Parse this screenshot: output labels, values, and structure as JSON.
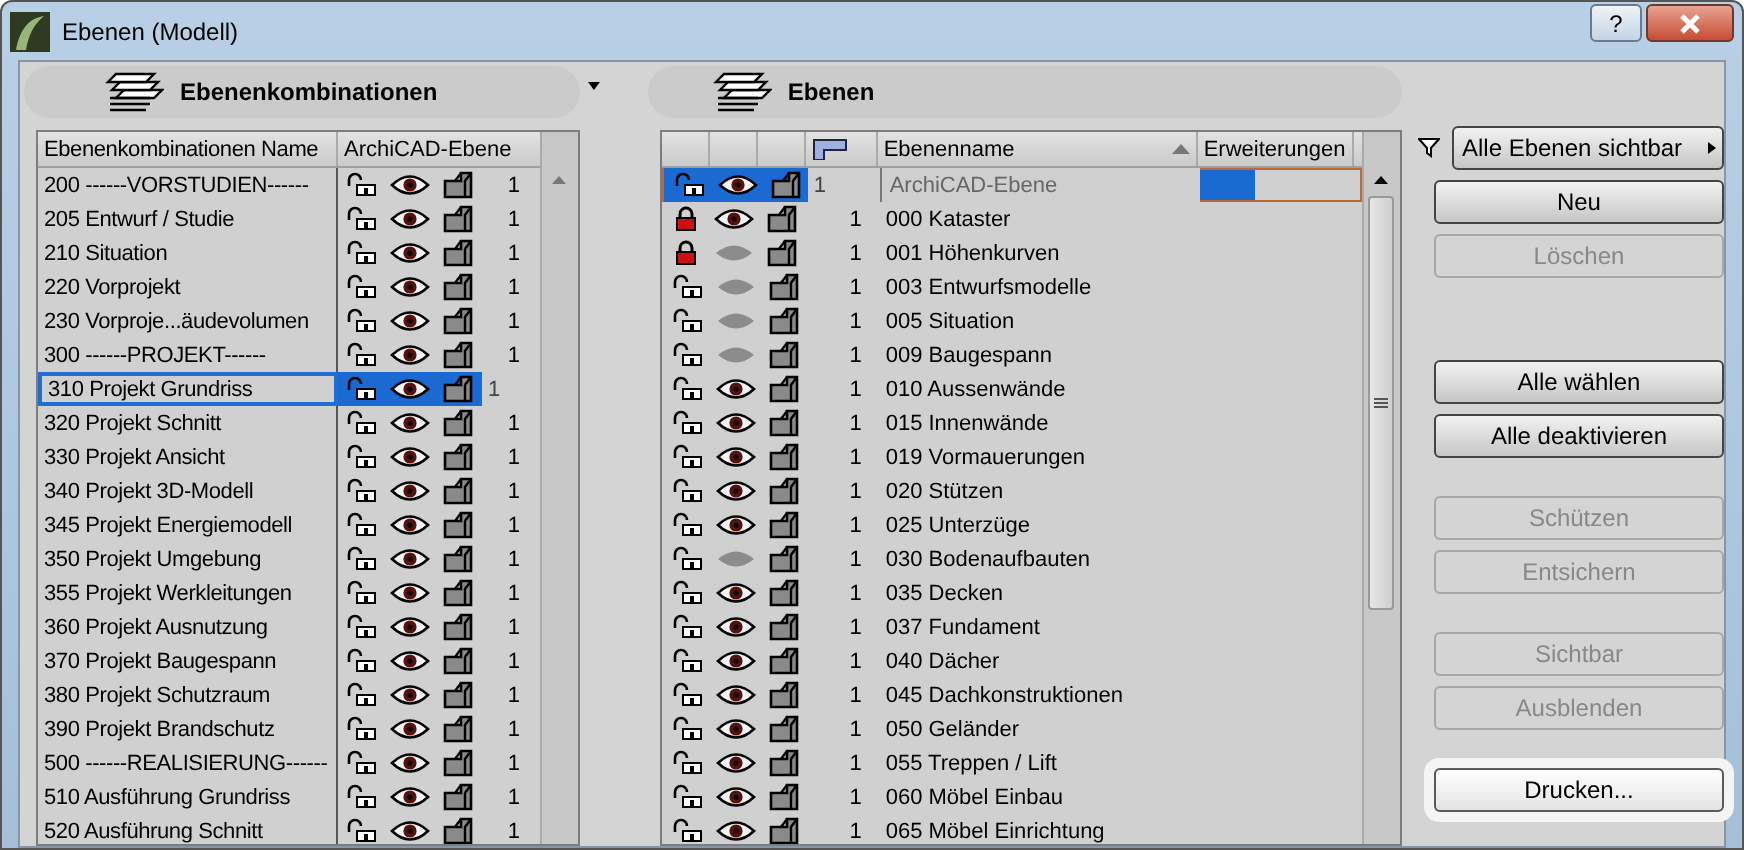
{
  "window": {
    "title": "Ebenen (Modell)",
    "help": "?"
  },
  "combinations": {
    "header": "Ebenenkombinationen",
    "columns": [
      "Ebenenkombinationen Name",
      "ArchiCAD-Ebene"
    ],
    "rows": [
      {
        "name": "200 ------VORSTUDIEN------",
        "locked": false,
        "visible": true,
        "number": "1",
        "selected": false
      },
      {
        "name": "205 Entwurf / Studie",
        "locked": false,
        "visible": true,
        "number": "1",
        "selected": false
      },
      {
        "name": "210 Situation",
        "locked": false,
        "visible": true,
        "number": "1",
        "selected": false
      },
      {
        "name": "220 Vorprojekt",
        "locked": false,
        "visible": true,
        "number": "1",
        "selected": false
      },
      {
        "name": "230 Vorproje...äudevolumen",
        "locked": false,
        "visible": true,
        "number": "1",
        "selected": false
      },
      {
        "name": "300 ------PROJEKT------",
        "locked": false,
        "visible": true,
        "number": "1",
        "selected": false
      },
      {
        "name": "310 Projekt Grundriss",
        "locked": false,
        "visible": true,
        "number": "1",
        "selected": true
      },
      {
        "name": "320 Projekt Schnitt",
        "locked": false,
        "visible": true,
        "number": "1",
        "selected": false
      },
      {
        "name": "330 Projekt Ansicht",
        "locked": false,
        "visible": true,
        "number": "1",
        "selected": false
      },
      {
        "name": "340 Projekt 3D-Modell",
        "locked": false,
        "visible": true,
        "number": "1",
        "selected": false
      },
      {
        "name": "345 Projekt Energiemodell",
        "locked": false,
        "visible": true,
        "number": "1",
        "selected": false
      },
      {
        "name": "350 Projekt Umgebung",
        "locked": false,
        "visible": true,
        "number": "1",
        "selected": false
      },
      {
        "name": "355 Projekt Werkleitungen",
        "locked": false,
        "visible": true,
        "number": "1",
        "selected": false
      },
      {
        "name": "360 Projekt Ausnutzung",
        "locked": false,
        "visible": true,
        "number": "1",
        "selected": false
      },
      {
        "name": "370 Projekt Baugespann",
        "locked": false,
        "visible": true,
        "number": "1",
        "selected": false
      },
      {
        "name": "380 Projekt Schutzraum",
        "locked": false,
        "visible": true,
        "number": "1",
        "selected": false
      },
      {
        "name": "390 Projekt Brandschutz",
        "locked": false,
        "visible": true,
        "number": "1",
        "selected": false
      },
      {
        "name": "500 ------REALISIERUNG------",
        "locked": false,
        "visible": true,
        "number": "1",
        "selected": false
      },
      {
        "name": "510 Ausführung Grundriss",
        "locked": false,
        "visible": true,
        "number": "1",
        "selected": false
      },
      {
        "name": "520 Ausführung Schnitt",
        "locked": false,
        "visible": true,
        "number": "1",
        "selected": false
      }
    ]
  },
  "layers": {
    "header": "Ebenen",
    "columns": [
      "Ebenenname",
      "Erweiterungen"
    ],
    "rows": [
      {
        "name": "ArchiCAD-Ebene",
        "locked": false,
        "visible": true,
        "number": "1",
        "selected": true
      },
      {
        "name": "000 Kataster",
        "locked": true,
        "visible": true,
        "number": "1",
        "selected": false
      },
      {
        "name": "001 Höhenkurven",
        "locked": true,
        "visible": false,
        "number": "1",
        "selected": false
      },
      {
        "name": "003 Entwurfsmodelle",
        "locked": false,
        "visible": false,
        "number": "1",
        "selected": false
      },
      {
        "name": "005 Situation",
        "locked": false,
        "visible": false,
        "number": "1",
        "selected": false
      },
      {
        "name": "009 Baugespann",
        "locked": false,
        "visible": false,
        "number": "1",
        "selected": false
      },
      {
        "name": "010 Aussenwände",
        "locked": false,
        "visible": true,
        "number": "1",
        "selected": false
      },
      {
        "name": "015 Innenwände",
        "locked": false,
        "visible": true,
        "number": "1",
        "selected": false
      },
      {
        "name": "019 Vormauerungen",
        "locked": false,
        "visible": true,
        "number": "1",
        "selected": false
      },
      {
        "name": "020 Stützen",
        "locked": false,
        "visible": true,
        "number": "1",
        "selected": false
      },
      {
        "name": "025 Unterzüge",
        "locked": false,
        "visible": true,
        "number": "1",
        "selected": false
      },
      {
        "name": "030 Bodenaufbauten",
        "locked": false,
        "visible": false,
        "number": "1",
        "selected": false
      },
      {
        "name": "035 Decken",
        "locked": false,
        "visible": true,
        "number": "1",
        "selected": false
      },
      {
        "name": "037 Fundament",
        "locked": false,
        "visible": true,
        "number": "1",
        "selected": false
      },
      {
        "name": "040 Dächer",
        "locked": false,
        "visible": true,
        "number": "1",
        "selected": false
      },
      {
        "name": "045 Dachkonstruktionen",
        "locked": false,
        "visible": true,
        "number": "1",
        "selected": false
      },
      {
        "name": "050 Geländer",
        "locked": false,
        "visible": true,
        "number": "1",
        "selected": false
      },
      {
        "name": "055 Treppen / Lift",
        "locked": false,
        "visible": true,
        "number": "1",
        "selected": false
      },
      {
        "name": "060 Möbel Einbau",
        "locked": false,
        "visible": true,
        "number": "1",
        "selected": false
      },
      {
        "name": "065 Möbel Einrichtung",
        "locked": false,
        "visible": true,
        "number": "1",
        "selected": false
      }
    ]
  },
  "filter": {
    "label": "Alle Ebenen sichtbar"
  },
  "button_groups": [
    [
      {
        "label": "Neu",
        "disabled": false,
        "focused": false
      },
      {
        "label": "Löschen",
        "disabled": true,
        "focused": false
      }
    ],
    [
      {
        "label": "Alle wählen",
        "disabled": false,
        "focused": false
      },
      {
        "label": "Alle deaktivieren",
        "disabled": false,
        "focused": false
      }
    ],
    [
      {
        "label": "Schützen",
        "disabled": true,
        "focused": false
      },
      {
        "label": "Entsichern",
        "disabled": true,
        "focused": false
      }
    ],
    [
      {
        "label": "Sichtbar",
        "disabled": true,
        "focused": false
      },
      {
        "label": "Ausblenden",
        "disabled": true,
        "focused": false
      }
    ],
    [
      {
        "label": "Drucken...",
        "disabled": false,
        "focused": true
      }
    ]
  ]
}
